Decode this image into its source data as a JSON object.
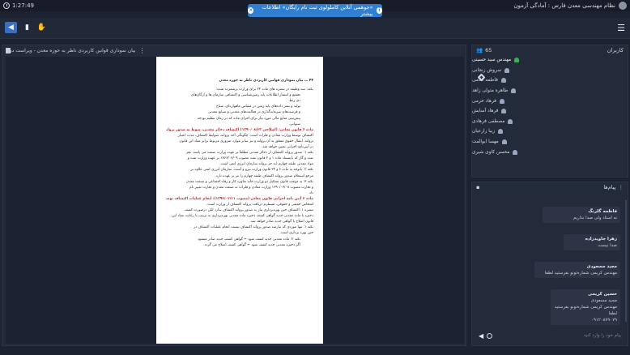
{
  "topbar": {
    "time": "1:27:49",
    "title": "نظام مهندسی معدن فارس : آمادگی آزمون"
  },
  "banner": {
    "text": "«جوهمی آنلاین کاملولوی ثبت نام رایگان» اطلاعات بیشتر"
  },
  "toolbar": {
    "icons": [
      "mic-icon",
      "file-icon",
      "hand-icon",
      "menu-icon"
    ]
  },
  "presentation": {
    "title": "بیان نموداری قوانین کاربردی ناظر به حوزه معدن - ویراست دوم",
    "page_header": "۴۴ ـــ بیان نموداری قوانین کاربردی ناظر به حوزه معدن",
    "lines": [
      "نکته: سه وظیفه در تبصره های ماده ۲۴ برای وزارت برشمرده شده:",
      "تجمیع و انتشار اطلاعات پایه زمین‌شناسی و اکتشافی سازمان ها و ارگان‌های",
      "ذی ربط",
      "تولید و نشر داده‌های پایه زمین در مقیاس ماهواره‌ای، شناخ",
      "و فرصت‌های سرمایه‌گذاری در فعالیت‌های معدنی و صنایع معدنی",
      "پیش‌بینی منابع مالی مورد نیاز برای اجرای ماده که در زمان تنظیم بودجه",
      "سنواتی.",
      "ماده ۶ قانون معادن: (اصلاحی ۱۳۹۰/۰۸/۲۳) اکتشاف ذخائر معدنی، منوط به صدور پروانه",
      "اکتشاف توسط وزارت معادن و فلزات است. چگونگی اخذ پروانه، ضوابط اکتشاف، مدت اعتبار",
      "پروانه، انتقال حقوق متعلق به آن پروانه و نیز سایر موارد ضروری مربوط برابر مفاد این قانون",
      "در آیین‌نامه اجرایی تعیین خواهد شد.",
      "نکته ۱: صدور پروانه اکتشاف از ذخائر معدنی مطلقاً بر عهده وزارت صمت می باشد، بجز",
      "نفت و گاز که بایستناد ماده ۱ و ۲ قانون نفت مصوب ۱۳۶۶/۰۷/۰۹ بر عهده وزارت نفت و",
      "مواد معدنی طبقه چهارم (به جز پروانه سازمان انرژی اتمی است.",
      "نکته ۲: باتوجه به ماده ۶ و ۲۴ قانون وزارت نیرو و است. سازمان انرژی اتمی علاوه بر",
      "مرجع استعلام صدور پروانه اکتشاف طبقه چهارم را نیز بر عهده دارد.",
      "نکته ۳: به موجب قانون تشکیل دو وزارت خانه تعاون، کار و رفاه اجتماعی و صنعت معدن",
      "و تجارت مصوب ۱۳۹۰/۰۳/۰۸ وزارت معادن و فلزات به صنعت معدن و تجارت تغییر نام",
      "داد.",
      "ماده ۲ آیین نامه اجرایی قانون معادن (مصوب ۱۳۹۲/۰۲/۱۱): انجام عملیات اکتشاف توسط",
      "اشخاص حقیقی و حقوقی، مستلزم دریافت پروانه اکتشاف از وزارت است.",
      "تبصره ۱: اکتشاف حین بهره‌برداری نیاز به صدور پروانه اکتشاف ندارد لکن درصورت کشف",
      "ذخیره یا ماده معدنی جدید گواهی کشف ذخیره ماده معدنی بهره‌برداری به ترتیب با رعایت مفاد این",
      "قانون اصلاح یا گواهی جدید صادر خواهد شد.",
      "نکته ۱: تنها موردی که نیازمند صدور پروانه اکتشاف نیست انجام عملیات اکتشاف در",
      "حین بهره برداری است.",
      "نکته ۲: ماده معدنی جدید کشف شود ← گواهی کشف جدید صادر میشود",
      "اگر ذخیره معدنی جدید کشف شود ← گواهی کشف اصلاح می گردد."
    ]
  },
  "users": {
    "title": "کاربران",
    "count": "65",
    "list": [
      "مهندس سید حسینی",
      "سروش زنجانی",
      "فاطمه غلامی",
      "طاهره متولی زاهد",
      "فرهاد خرمی",
      "فرهاد آسایش",
      "مصطفی فرهادی",
      "زیبا زارعیان",
      "مهسا ابوالفت",
      "محسن کاوی شیری"
    ]
  },
  "chat": {
    "title": "پیام‌ها",
    "messages": [
      {
        "who": "فاطمه گلرنگ",
        "text": "نه استاد ولی صدا نداریم"
      },
      {
        "who": "زهرا جاویدزاده",
        "text": "صدا نیست"
      },
      {
        "who": "مجید مسعودی",
        "text": "مهندس کریمی شماره‌تونو بفرستید لطفا"
      },
      {
        "who": "حسین کریمی",
        "text": "مجید مسعودی",
        "extra": "مهندس کریمی شماره‌تونو بفرستید لطفا",
        "phone": "۰۹۱۲۰۸۷۹۰۷۹"
      }
    ],
    "input_placeholder": "پیام خود را وارد کنید"
  }
}
